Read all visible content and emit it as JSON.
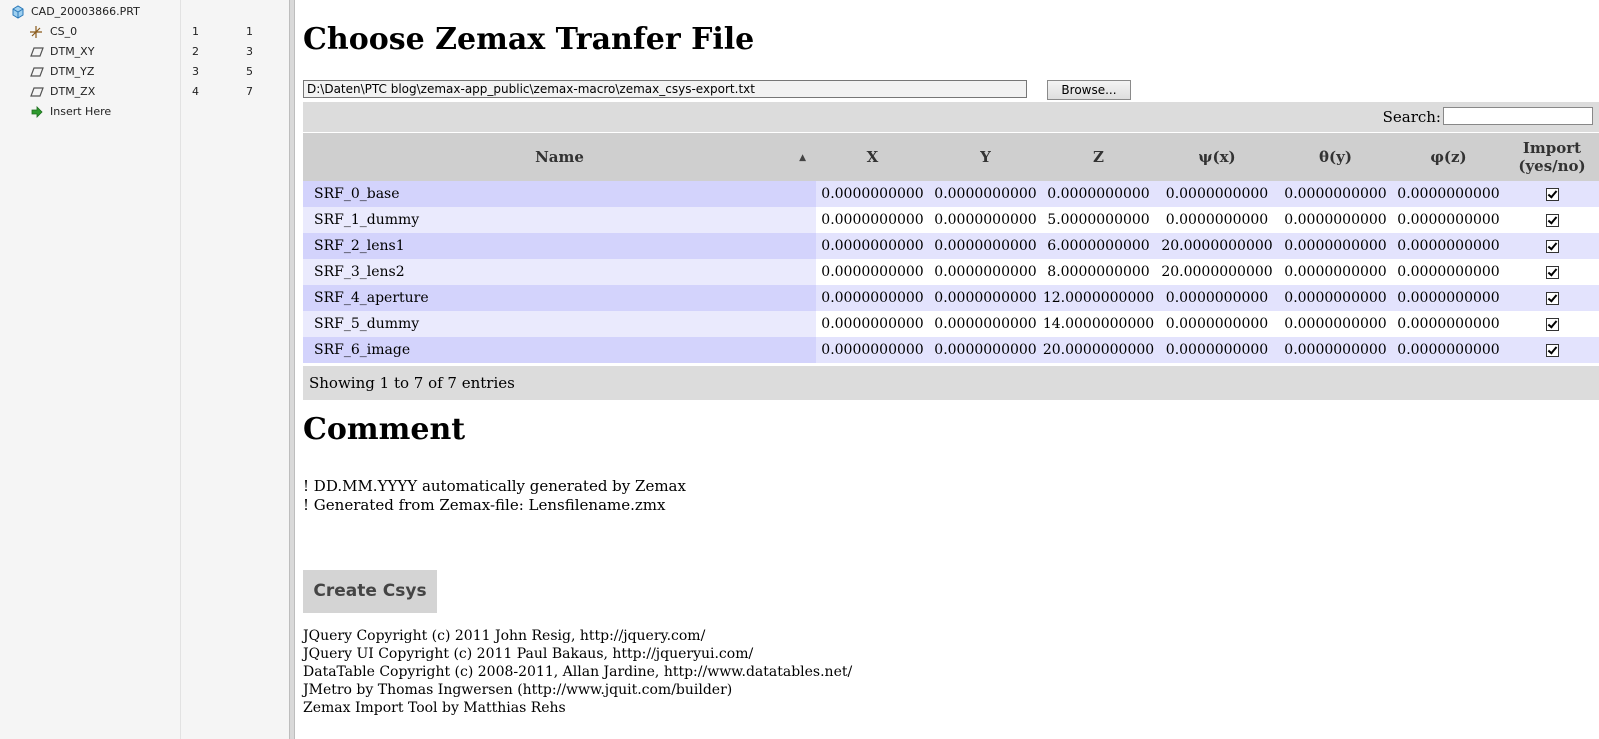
{
  "tree": {
    "items": [
      {
        "label": "CAD_20003866.PRT",
        "n1": "",
        "n2": "",
        "icon": "part-icon"
      },
      {
        "label": "CS_0",
        "n1": "1",
        "n2": "1",
        "icon": "csys-icon"
      },
      {
        "label": "DTM_XY",
        "n1": "2",
        "n2": "3",
        "icon": "datum-plane-icon"
      },
      {
        "label": "DTM_YZ",
        "n1": "3",
        "n2": "5",
        "icon": "datum-plane-icon"
      },
      {
        "label": "DTM_ZX",
        "n1": "4",
        "n2": "7",
        "icon": "datum-plane-icon"
      },
      {
        "label": "Insert Here",
        "n1": "",
        "n2": "",
        "icon": "insert-arrow-icon"
      }
    ]
  },
  "page": {
    "title": "Choose Zemax Tranfer File",
    "file_path": "D:\\Daten\\PTC blog\\zemax-app_public\\zemax-macro\\zemax_csys-export.txt",
    "browse_label": "Browse...",
    "search_label": "Search:",
    "search_value": ""
  },
  "table": {
    "headers": {
      "name": "Name",
      "x": "X",
      "y": "Y",
      "z": "Z",
      "psi": "ψ(x)",
      "theta": "θ(y)",
      "phi": "φ(z)",
      "import_l1": "Import",
      "import_l2": "(yes/no)"
    },
    "rows": [
      {
        "name": "SRF_0_base",
        "x": "0.0000000000",
        "y": "0.0000000000",
        "z": "0.0000000000",
        "psi": "0.0000000000",
        "theta": "0.0000000000",
        "phi": "0.0000000000",
        "import": true
      },
      {
        "name": "SRF_1_dummy",
        "x": "0.0000000000",
        "y": "0.0000000000",
        "z": "5.0000000000",
        "psi": "0.0000000000",
        "theta": "0.0000000000",
        "phi": "0.0000000000",
        "import": true
      },
      {
        "name": "SRF_2_lens1",
        "x": "0.0000000000",
        "y": "0.0000000000",
        "z": "6.0000000000",
        "psi": "20.0000000000",
        "theta": "0.0000000000",
        "phi": "0.0000000000",
        "import": true
      },
      {
        "name": "SRF_3_lens2",
        "x": "0.0000000000",
        "y": "0.0000000000",
        "z": "8.0000000000",
        "psi": "20.0000000000",
        "theta": "0.0000000000",
        "phi": "0.0000000000",
        "import": true
      },
      {
        "name": "SRF_4_aperture",
        "x": "0.0000000000",
        "y": "0.0000000000",
        "z": "12.0000000000",
        "psi": "0.0000000000",
        "theta": "0.0000000000",
        "phi": "0.0000000000",
        "import": true
      },
      {
        "name": "SRF_5_dummy",
        "x": "0.0000000000",
        "y": "0.0000000000",
        "z": "14.0000000000",
        "psi": "0.0000000000",
        "theta": "0.0000000000",
        "phi": "0.0000000000",
        "import": true
      },
      {
        "name": "SRF_6_image",
        "x": "0.0000000000",
        "y": "0.0000000000",
        "z": "20.0000000000",
        "psi": "0.0000000000",
        "theta": "0.0000000000",
        "phi": "0.0000000000",
        "import": true
      }
    ],
    "info": "Showing 1 to 7 of 7 entries"
  },
  "comment": {
    "title": "Comment",
    "lines": [
      "! DD.MM.YYYY automatically generated by Zemax",
      "! Generated from Zemax-file: Lensfilename.zmx"
    ]
  },
  "create_button": "Create Csys",
  "credits": [
    "JQuery Copyright (c) 2011 John Resig, http://jquery.com/",
    "JQuery UI Copyright (c) 2011 Paul Bakaus, http://jqueryui.com/",
    "DataTable Copyright (c) 2008-2011, Allan Jardine, http://www.datatables.net/",
    "JMetro by Thomas Ingwersen (http://www.jquit.com/builder)",
    "Zemax Import Tool by Matthias Rehs"
  ],
  "colors": {
    "row_odd_name": "#d3d3fc",
    "row_odd": "#e3e3fd",
    "row_even_name": "#eaeafd",
    "header_bg": "#cfcfcf",
    "bar_bg": "#dcdcdc"
  }
}
